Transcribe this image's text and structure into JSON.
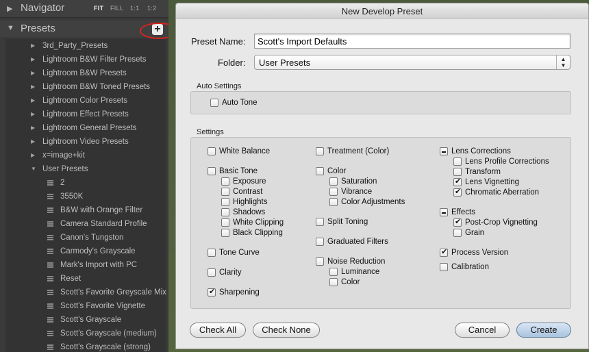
{
  "navigator": {
    "title": "Navigator",
    "zoom_options": [
      "FIT",
      "FILL",
      "1:1",
      "1:2"
    ],
    "active_zoom": "FIT"
  },
  "presets": {
    "title": "Presets",
    "add_button_label": "+",
    "folders": [
      "3rd_Party_Presets",
      "Lightroom B&W Filter Presets",
      "Lightroom B&W Presets",
      "Lightroom B&W Toned Presets",
      "Lightroom Color Presets",
      "Lightroom Effect Presets",
      "Lightroom General Presets",
      "Lightroom Video Presets",
      "x=image+kit",
      "User Presets"
    ],
    "user_presets": [
      "2",
      "3550K",
      "B&W with Orange Filter",
      "Camera Standard Profile",
      "Canon's Tungston",
      "Carmody's Grayscale",
      "Mark's Import with PC",
      "Reset",
      "Scott's Favorite Greyscale Mix",
      "Scott's Favorite Vignette",
      "Scott's Grayscale",
      "Scott's Grayscale (medium)",
      "Scott's Grayscale (strong)"
    ]
  },
  "dialog": {
    "title": "New Develop Preset",
    "preset_name_label": "Preset Name:",
    "preset_name_value": "Scott's Import Defaults",
    "folder_label": "Folder:",
    "folder_value": "User Presets",
    "auto_settings_title": "Auto Settings",
    "auto_tone": {
      "label": "Auto Tone",
      "state": "unchecked"
    },
    "settings_title": "Settings",
    "col1": [
      {
        "label": "White Balance",
        "state": "unchecked"
      },
      {
        "label": "Basic Tone",
        "state": "unchecked"
      },
      {
        "label": "Exposure",
        "state": "unchecked"
      },
      {
        "label": "Contrast",
        "state": "unchecked"
      },
      {
        "label": "Highlights",
        "state": "unchecked"
      },
      {
        "label": "Shadows",
        "state": "unchecked"
      },
      {
        "label": "White Clipping",
        "state": "unchecked"
      },
      {
        "label": "Black Clipping",
        "state": "unchecked"
      },
      {
        "label": "Tone Curve",
        "state": "unchecked"
      },
      {
        "label": "Clarity",
        "state": "unchecked"
      },
      {
        "label": "Sharpening",
        "state": "checked"
      }
    ],
    "col2": [
      {
        "label": "Treatment (Color)",
        "state": "unchecked"
      },
      {
        "label": "Color",
        "state": "unchecked"
      },
      {
        "label": "Saturation",
        "state": "unchecked"
      },
      {
        "label": "Vibrance",
        "state": "unchecked"
      },
      {
        "label": "Color Adjustments",
        "state": "unchecked"
      },
      {
        "label": "Split Toning",
        "state": "unchecked"
      },
      {
        "label": "Graduated Filters",
        "state": "unchecked"
      },
      {
        "label": "Noise Reduction",
        "state": "unchecked"
      },
      {
        "label": "Luminance",
        "state": "unchecked"
      },
      {
        "label": "Color",
        "state": "unchecked"
      }
    ],
    "col3": [
      {
        "label": "Lens Corrections",
        "state": "mixed"
      },
      {
        "label": "Lens Profile Corrections",
        "state": "unchecked"
      },
      {
        "label": "Transform",
        "state": "unchecked"
      },
      {
        "label": "Lens Vignetting",
        "state": "checked"
      },
      {
        "label": "Chromatic Aberration",
        "state": "checked"
      },
      {
        "label": "Effects",
        "state": "mixed"
      },
      {
        "label": "Post-Crop Vignetting",
        "state": "checked"
      },
      {
        "label": "Grain",
        "state": "unchecked"
      },
      {
        "label": "Process Version",
        "state": "checked"
      },
      {
        "label": "Calibration",
        "state": "unchecked"
      }
    ],
    "buttons": {
      "check_all": "Check All",
      "check_none": "Check None",
      "cancel": "Cancel",
      "create": "Create"
    }
  }
}
